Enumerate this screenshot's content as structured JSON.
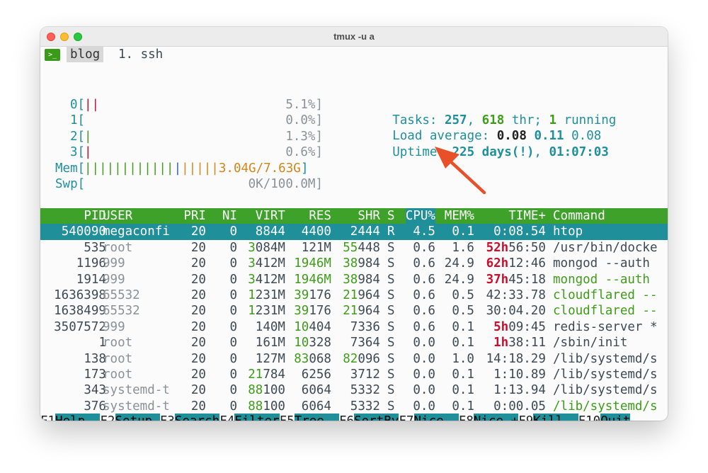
{
  "window": {
    "title": "tmux -u a"
  },
  "tmux": {
    "session": "blog",
    "window_label": "1. ssh"
  },
  "cpus": [
    {
      "label": "0[",
      "bar": [
        {
          "t": "||",
          "c": "red"
        }
      ],
      "pct": "5.1%]"
    },
    {
      "label": "1[",
      "bar": [],
      "pct": "0.0%]"
    },
    {
      "label": "2[",
      "bar": [
        {
          "t": "|",
          "c": "green"
        }
      ],
      "pct": "1.3%]"
    },
    {
      "label": "3[",
      "bar": [
        {
          "t": "|",
          "c": "red"
        }
      ],
      "pct": "0.6%]"
    }
  ],
  "mem": {
    "label": "Mem[",
    "bar_green": "||||||||||||",
    "bar_blue": "|",
    "bar_orange": "|||||",
    "value": "3.04G/7.63G",
    "close": "]"
  },
  "swp": {
    "label": "Swp[",
    "value": "0K/100.0M",
    "close": "]"
  },
  "stats": {
    "tasks_label": "Tasks: ",
    "tasks": "257",
    "sep1": ", ",
    "threads": "618",
    "thr_label": " thr; ",
    "running": "1",
    "running_label": " running",
    "load_label": "Load average: ",
    "load1": "0.08",
    "load5": "0.11",
    "load15": "0.08",
    "uptime_label": "Uptime: ",
    "uptime_days": "225 days(!)",
    "uptime_sep": ", ",
    "uptime_time": "01:07:03"
  },
  "columns": [
    "PID",
    "USER",
    "PRI",
    "NI",
    "VIRT",
    "RES",
    "SHR",
    "S",
    "CPU%",
    "MEM%",
    "TIME+",
    "Command"
  ],
  "processes": [
    {
      "pid": "540090",
      "user": "megaconfi",
      "pri": "20",
      "ni": "0",
      "virt": "8844",
      "res": "4400",
      "shr": "2444",
      "s": "R",
      "cpu": "4.5",
      "mem": "0.1",
      "time_h": "",
      "time": "0:08.54",
      "cmd": "htop",
      "selected": true
    },
    {
      "pid": "535",
      "user": "root",
      "pri": "20",
      "ni": "0",
      "virt_g": "3",
      "virt": "084M",
      "res_g": "",
      "res": "121M",
      "shr_g": "55",
      "shr": "448",
      "s": "S",
      "cpu": "0.6",
      "mem": "1.6",
      "time_h": "52h",
      "time": "56:50",
      "cmd": "/usr/bin/docke",
      "cmd_green": false
    },
    {
      "pid": "1196",
      "user": "999",
      "pri": "20",
      "ni": "0",
      "virt_g": "3",
      "virt": "412M",
      "res_g": "1946M",
      "res": "",
      "shr_g": "38",
      "shr": "984",
      "s": "S",
      "cpu": "0.6",
      "mem": "24.9",
      "time_h": "62h",
      "time": "12:46",
      "cmd": "mongod --auth",
      "cmd_green": false
    },
    {
      "pid": "1914",
      "user": "999",
      "pri": "20",
      "ni": "0",
      "virt_g": "3",
      "virt": "412M",
      "res_g": "1946M",
      "res": "",
      "shr_g": "38",
      "shr": "984",
      "s": "S",
      "cpu": "0.6",
      "mem": "24.9",
      "time_h": "37h",
      "time": "45:18",
      "cmd": "mongod --auth",
      "cmd_green": true
    },
    {
      "pid": "1636398",
      "user": "65532",
      "pri": "20",
      "ni": "0",
      "virt_g": "1",
      "virt": "231M",
      "res_g": "39",
      "res": "176",
      "shr_g": "21",
      "shr": "964",
      "s": "S",
      "cpu": "0.6",
      "mem": "0.5",
      "time_h": "",
      "time": "42:33.78",
      "cmd": "cloudflared --",
      "cmd_green": true
    },
    {
      "pid": "1638499",
      "user": "65532",
      "pri": "20",
      "ni": "0",
      "virt_g": "1",
      "virt": "231M",
      "res_g": "39",
      "res": "176",
      "shr_g": "21",
      "shr": "964",
      "s": "S",
      "cpu": "0.6",
      "mem": "0.5",
      "time_h": "",
      "time": "30:04.20",
      "cmd": "cloudflared --",
      "cmd_green": true
    },
    {
      "pid": "3507572",
      "user": "999",
      "pri": "20",
      "ni": "0",
      "virt_g": "",
      "virt": "140M",
      "res_g": "10",
      "res": "404",
      "shr_g": "",
      "shr": "7336",
      "s": "S",
      "cpu": "0.6",
      "mem": "0.1",
      "time_h": "5h",
      "time": "09:45",
      "cmd": "redis-server *",
      "cmd_green": false
    },
    {
      "pid": "1",
      "user": "root",
      "pri": "20",
      "ni": "0",
      "virt_g": "",
      "virt": "161M",
      "res_g": "10",
      "res": "328",
      "shr_g": "",
      "shr": "7364",
      "s": "S",
      "cpu": "0.0",
      "mem": "0.1",
      "time_h": "1h",
      "time": "38:11",
      "cmd": "/sbin/init",
      "cmd_green": false
    },
    {
      "pid": "138",
      "user": "root",
      "pri": "20",
      "ni": "0",
      "virt_g": "",
      "virt": "127M",
      "res_g": "83",
      "res": "068",
      "shr_g": "82",
      "shr": "096",
      "s": "S",
      "cpu": "0.0",
      "mem": "1.0",
      "time_h": "",
      "time": "14:18.29",
      "cmd": "/lib/systemd/s",
      "cmd_green": false
    },
    {
      "pid": "173",
      "user": "root",
      "pri": "20",
      "ni": "0",
      "virt_g": "21",
      "virt": "784",
      "res_g": "",
      "res": "6256",
      "shr_g": "",
      "shr": "3712",
      "s": "S",
      "cpu": "0.0",
      "mem": "0.1",
      "time_h": "",
      "time": "1:10.89",
      "cmd": "/lib/systemd/s",
      "cmd_green": false
    },
    {
      "pid": "343",
      "user": "systemd-t",
      "pri": "20",
      "ni": "0",
      "virt_g": "88",
      "virt": "100",
      "res_g": "",
      "res": "6064",
      "shr_g": "",
      "shr": "5332",
      "s": "S",
      "cpu": "0.0",
      "mem": "0.1",
      "time_h": "",
      "time": "1:13.94",
      "cmd": "/lib/systemd/s",
      "cmd_green": false
    },
    {
      "pid": "376",
      "user": "systemd-t",
      "pri": "20",
      "ni": "0",
      "virt_g": "88",
      "virt": "100",
      "res_g": "",
      "res": "6064",
      "shr_g": "",
      "shr": "5332",
      "s": "S",
      "cpu": "0.0",
      "mem": "0.1",
      "time_h": "",
      "time": "0:00.05",
      "cmd": "/lib/systemd/s",
      "cmd_green": true
    }
  ],
  "fkeys": [
    {
      "key": "F1",
      "label": "Help  "
    },
    {
      "key": "F2",
      "label": "Setup "
    },
    {
      "key": "F3",
      "label": "Search"
    },
    {
      "key": "F4",
      "label": "Filter"
    },
    {
      "key": "F5",
      "label": "Tree  "
    },
    {
      "key": "F6",
      "label": "SortBy"
    },
    {
      "key": "F7",
      "label": "Nice -"
    },
    {
      "key": "F8",
      "label": "Nice +"
    },
    {
      "key": "F9",
      "label": "Kill  "
    },
    {
      "key": "F10",
      "label": "Quit"
    }
  ],
  "colors": {
    "accent_teal": "#1f8f9a",
    "header_green": "#3ea22a",
    "annotation_arrow": "#e8502a",
    "time_hours_red": "#c8102e"
  }
}
